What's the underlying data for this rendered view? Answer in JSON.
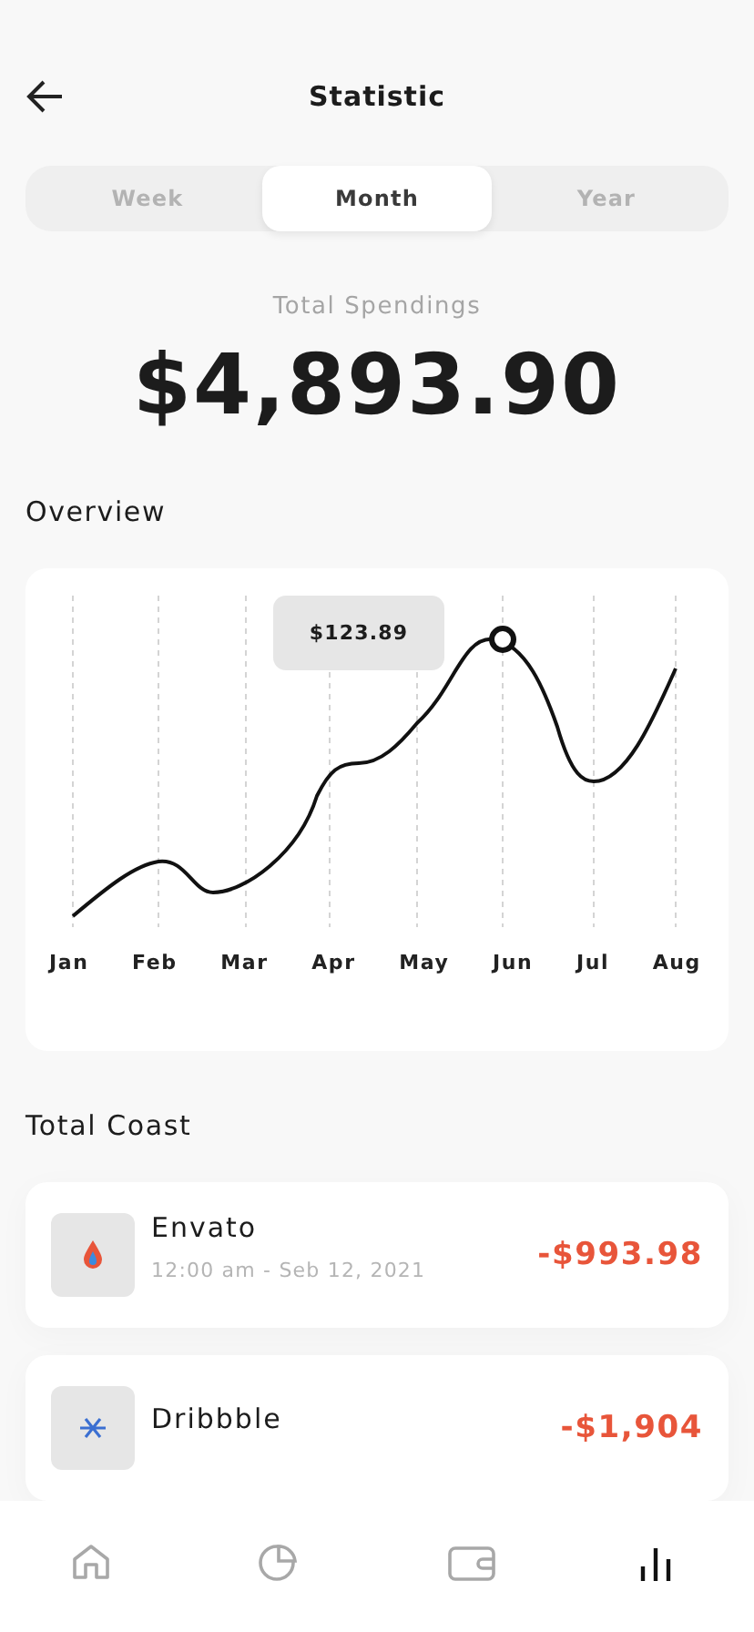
{
  "header": {
    "title": "Statistic"
  },
  "tabs": [
    {
      "label": "Week",
      "selected": false
    },
    {
      "label": "Month",
      "selected": true
    },
    {
      "label": "Year",
      "selected": false
    }
  ],
  "total": {
    "label": "Total Spendings",
    "amount": "$4,893.90"
  },
  "overview": {
    "title": "Overview",
    "tooltip": "$123.89",
    "months": [
      "Jan",
      "Feb",
      "Mar",
      "Apr",
      "May",
      "Jun",
      "Jul",
      "Aug"
    ]
  },
  "transactions_title": "Total Coast",
  "transactions": [
    {
      "name": "Envato",
      "time": "12:00 am - Seb 12, 2021",
      "amount": "-$993.98",
      "kind": "drop"
    },
    {
      "name": "Dribbble",
      "amount": "-$1,904",
      "kind": "flake"
    }
  ],
  "nav": [
    {
      "kind": "home",
      "selected": false
    },
    {
      "kind": "pie",
      "selected": false
    },
    {
      "kind": "wallet",
      "selected": false
    },
    {
      "kind": "stats",
      "selected": true
    }
  ]
}
